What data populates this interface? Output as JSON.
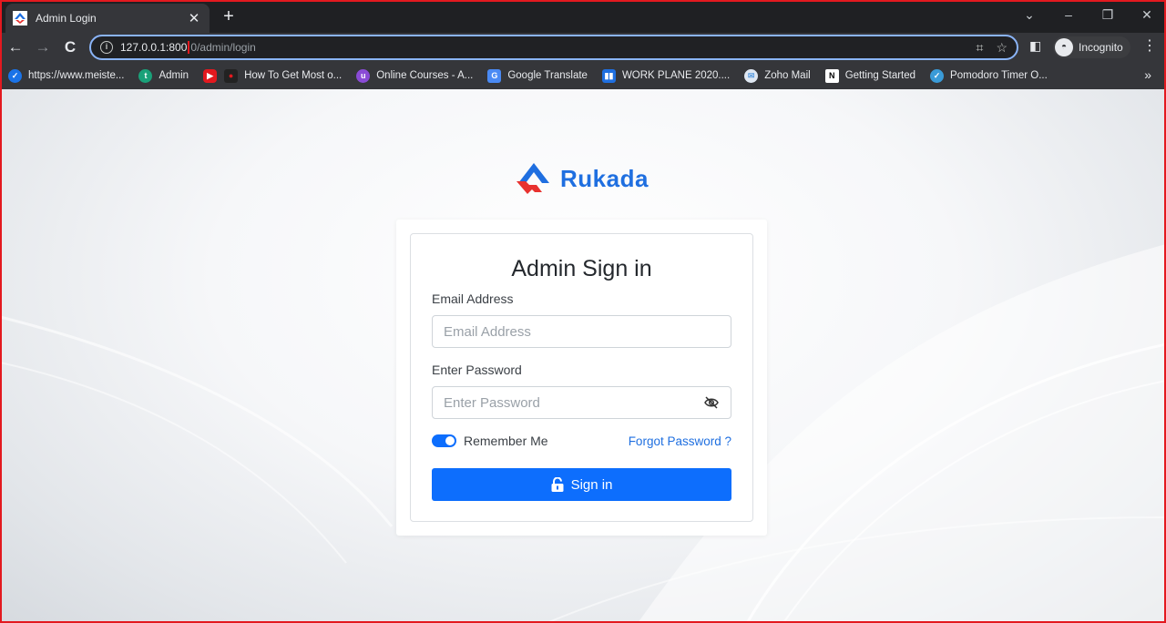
{
  "browser": {
    "tab_title": "Admin Login",
    "url_host": "127.0.0.1:800",
    "url_port_tail": "0",
    "url_path": "/admin/login",
    "profile_label": "Incognito",
    "bookmarks": [
      {
        "label": "https://www.meiste...",
        "icon": "check-icon",
        "color": "#1a73e8"
      },
      {
        "label": "Admin",
        "icon": "tailwind-icon",
        "color": "#1aa179"
      },
      {
        "label": "",
        "icon": "youtube-icon",
        "color": "#e3191f"
      },
      {
        "label": "How To Get Most o...",
        "icon": "video-icon",
        "color": "#e3191f"
      },
      {
        "label": "Online Courses - A...",
        "icon": "udemy-icon",
        "color": "#8a4bd6"
      },
      {
        "label": "Google Translate",
        "icon": "translate-icon",
        "color": "#4a8af4"
      },
      {
        "label": "WORK PLANE 2020....",
        "icon": "trello-icon",
        "color": "#1f6fe0"
      },
      {
        "label": "Zoho Mail",
        "icon": "mail-icon",
        "color": "#5a9ce0"
      },
      {
        "label": "Getting Started",
        "icon": "notion-icon",
        "color": "#ffffff"
      },
      {
        "label": "Pomodoro Timer O...",
        "icon": "timer-icon",
        "color": "#3a9bd8"
      }
    ]
  },
  "brand": {
    "name": "Rukada",
    "accent": "#1f6fe0",
    "logo_red": "#e8322f"
  },
  "login": {
    "title": "Admin Sign in",
    "email_label": "Email Address",
    "email_placeholder": "Email Address",
    "password_label": "Enter Password",
    "password_placeholder": "Enter Password",
    "remember_label": "Remember Me",
    "remember_checked": true,
    "forgot_label": "Forgot Password ?",
    "signin_label": "Sign in",
    "primary_color": "#0d6efd"
  }
}
